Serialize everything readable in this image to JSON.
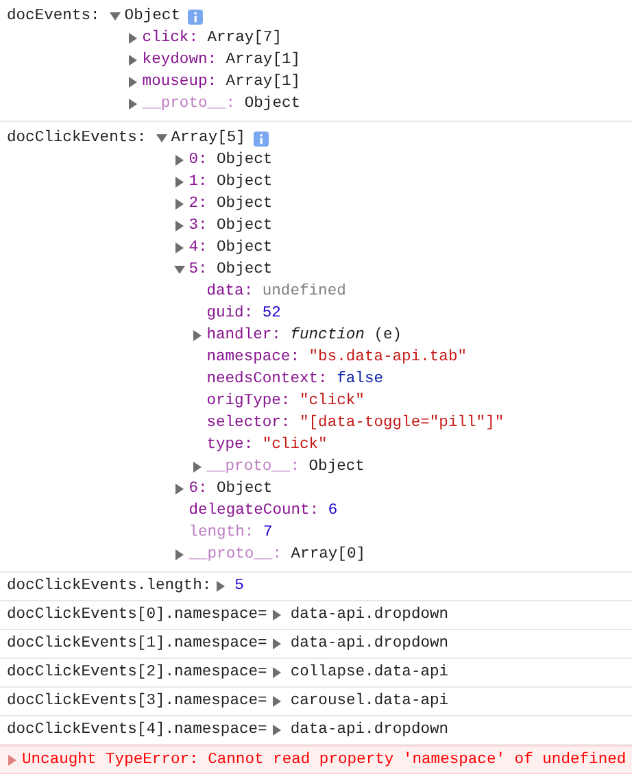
{
  "console": [
    {
      "kind": "tree",
      "label": "docEvents:",
      "root": {
        "value": "Object",
        "expanded": true,
        "info": true,
        "children": [
          {
            "key": "click:",
            "value": "Array[7]",
            "kind": "object",
            "expandable": true,
            "expanded": false
          },
          {
            "key": "keydown:",
            "value": "Array[1]",
            "kind": "object",
            "expandable": true,
            "expanded": false
          },
          {
            "key": "mouseup:",
            "value": "Array[1]",
            "kind": "object",
            "expandable": true,
            "expanded": false
          },
          {
            "key": "__proto__:",
            "value": "Object",
            "kind": "object",
            "expandable": true,
            "expanded": false,
            "faded": true
          }
        ]
      }
    },
    {
      "kind": "tree",
      "label": "docClickEvents:",
      "root": {
        "value": "Array[5]",
        "expanded": true,
        "info": true,
        "children": [
          {
            "key": "0:",
            "value": "Object",
            "kind": "object",
            "expandable": true,
            "expanded": false
          },
          {
            "key": "1:",
            "value": "Object",
            "kind": "object",
            "expandable": true,
            "expanded": false
          },
          {
            "key": "2:",
            "value": "Object",
            "kind": "object",
            "expandable": true,
            "expanded": false
          },
          {
            "key": "3:",
            "value": "Object",
            "kind": "object",
            "expandable": true,
            "expanded": false
          },
          {
            "key": "4:",
            "value": "Object",
            "kind": "object",
            "expandable": true,
            "expanded": false
          },
          {
            "key": "5:",
            "value": "Object",
            "kind": "object",
            "expandable": true,
            "expanded": true,
            "children": [
              {
                "key": "data:",
                "value": "undefined",
                "kind": "undefined",
                "expandable": false
              },
              {
                "key": "guid:",
                "value": "52",
                "kind": "number",
                "expandable": false
              },
              {
                "key": "handler:",
                "value": "*function* (e)",
                "kind": "function",
                "expandable": true,
                "expanded": false
              },
              {
                "key": "namespace:",
                "value": "\"bs.data-api.tab\"",
                "kind": "string",
                "expandable": false
              },
              {
                "key": "needsContext:",
                "value": "false",
                "kind": "boolean",
                "expandable": false
              },
              {
                "key": "origType:",
                "value": "\"click\"",
                "kind": "string",
                "expandable": false
              },
              {
                "key": "selector:",
                "value": "\"[data-toggle=\"pill\"]\"",
                "kind": "string",
                "expandable": false
              },
              {
                "key": "type:",
                "value": "\"click\"",
                "kind": "string",
                "expandable": false
              },
              {
                "key": "__proto__:",
                "value": "Object",
                "kind": "object",
                "expandable": true,
                "expanded": false,
                "faded": true
              }
            ]
          },
          {
            "key": "6:",
            "value": "Object",
            "kind": "object",
            "expandable": true,
            "expanded": false
          },
          {
            "key": "delegateCount:",
            "value": "6",
            "kind": "number",
            "expandable": false
          },
          {
            "key": "length:",
            "value": "7",
            "kind": "number",
            "expandable": false,
            "faded": true
          },
          {
            "key": "__proto__:",
            "value": "Array[0]",
            "kind": "object",
            "expandable": true,
            "expanded": false,
            "faded": true
          }
        ]
      }
    },
    {
      "kind": "log",
      "text": "docClickEvents.length:",
      "value": {
        "text": "5",
        "kind": "number"
      },
      "expandable": true
    },
    {
      "kind": "log",
      "text": "docClickEvents[0].namespace=",
      "value": {
        "text": "data-api.dropdown",
        "kind": "object"
      },
      "expandable": true
    },
    {
      "kind": "log",
      "text": "docClickEvents[1].namespace=",
      "value": {
        "text": "data-api.dropdown",
        "kind": "object"
      },
      "expandable": true
    },
    {
      "kind": "log",
      "text": "docClickEvents[2].namespace=",
      "value": {
        "text": "collapse.data-api",
        "kind": "object"
      },
      "expandable": true
    },
    {
      "kind": "log",
      "text": "docClickEvents[3].namespace=",
      "value": {
        "text": "carousel.data-api",
        "kind": "object"
      },
      "expandable": true
    },
    {
      "kind": "log",
      "text": "docClickEvents[4].namespace=",
      "value": {
        "text": "data-api.dropdown",
        "kind": "object"
      },
      "expandable": true
    },
    {
      "kind": "error",
      "text": "Uncaught TypeError: Cannot read property 'namespace' of undefined",
      "expandable": true
    }
  ]
}
